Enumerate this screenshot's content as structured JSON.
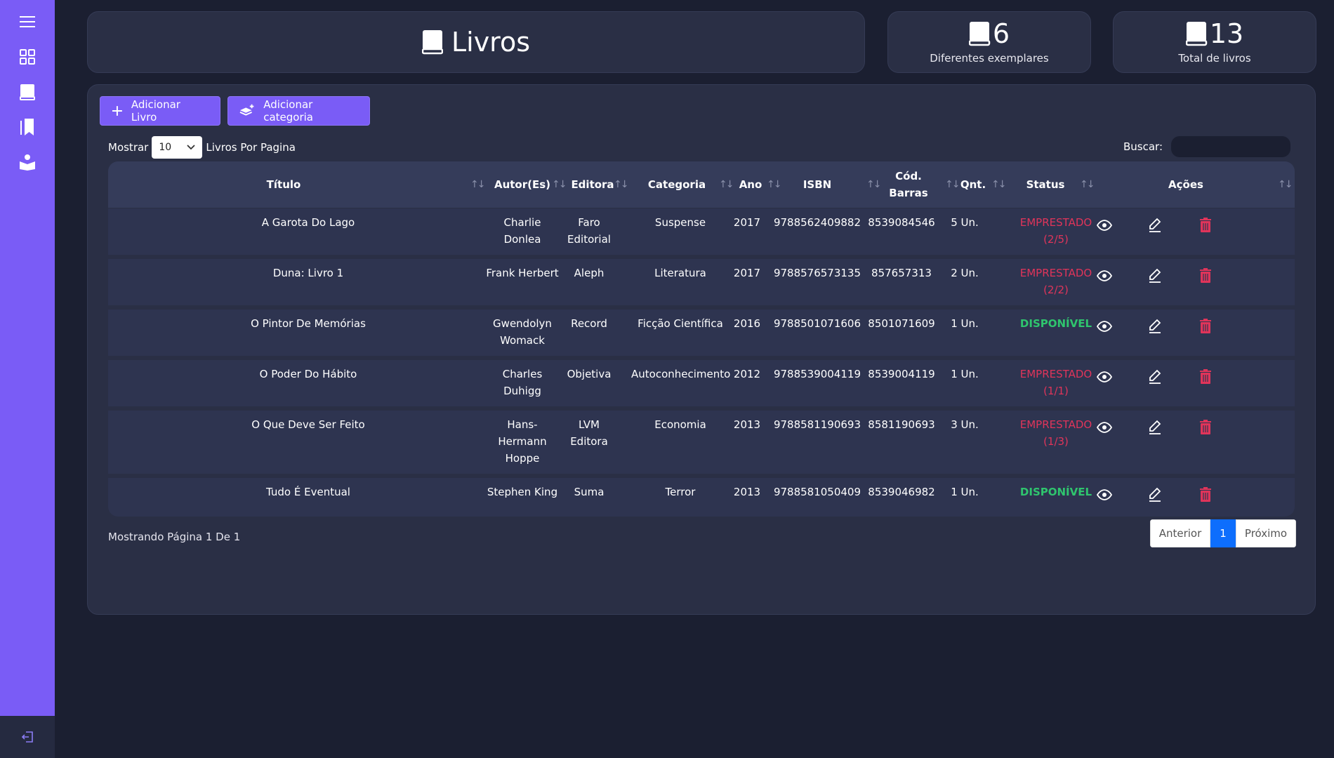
{
  "page": {
    "title": "Livros"
  },
  "stats": [
    {
      "value": "6",
      "label": "Diferentes exemplares"
    },
    {
      "value": "13",
      "label": "Total de livros"
    }
  ],
  "actions": {
    "add_book": "Adicionar Livro",
    "add_category": "Adicionar categoria"
  },
  "controls": {
    "show_label": "Mostrar",
    "page_size": "10",
    "per_page_label": "Livros Por Pagina",
    "search_label": "Buscar:",
    "search_value": ""
  },
  "table": {
    "headers": {
      "titulo": "Título",
      "autor": "Autor(Es)",
      "editora": "Editora",
      "categoria": "Categoria",
      "ano": "Ano",
      "isbn": "ISBN",
      "barras_1": "Cód.",
      "barras_2": "Barras",
      "qnt": "Qnt.",
      "status": "Status",
      "acoes": "Ações"
    },
    "rows": [
      {
        "titulo": "A Garota Do Lago",
        "autor": [
          "Charlie",
          "Donlea"
        ],
        "editora": [
          "Faro",
          "Editorial"
        ],
        "categoria": "Suspense",
        "ano": "2017",
        "isbn": "9788562409882",
        "barras": "8539084546",
        "qnt": "5 Un.",
        "status": [
          "EMPRESTADO",
          "(2/5)"
        ],
        "status_type": "emprestado"
      },
      {
        "titulo": "Duna: Livro 1",
        "autor": [
          "Frank Herbert"
        ],
        "editora": [
          "Aleph"
        ],
        "categoria": "Literatura",
        "ano": "2017",
        "isbn": "9788576573135",
        "barras": "857657313",
        "qnt": "2 Un.",
        "status": [
          "EMPRESTADO",
          "(2/2)"
        ],
        "status_type": "emprestado"
      },
      {
        "titulo": "O Pintor De Memórias",
        "autor": [
          "Gwendolyn",
          "Womack"
        ],
        "editora": [
          "Record"
        ],
        "categoria": "Ficção Científica",
        "ano": "2016",
        "isbn": "9788501071606",
        "barras": "8501071609",
        "qnt": "1 Un.",
        "status": [
          "DISPONÍVEL"
        ],
        "status_type": "disponivel"
      },
      {
        "titulo": "O Poder Do Hábito",
        "autor": [
          "Charles",
          "Duhigg"
        ],
        "editora": [
          "Objetiva"
        ],
        "categoria": "Autoconhecimento",
        "ano": "2012",
        "isbn": "9788539004119",
        "barras": "8539004119",
        "qnt": "1 Un.",
        "status": [
          "EMPRESTADO",
          "(1/1)"
        ],
        "status_type": "emprestado"
      },
      {
        "titulo": "O Que Deve Ser Feito",
        "autor": [
          "Hans-",
          "Hermann",
          "Hoppe"
        ],
        "editora": [
          "LVM",
          "Editora"
        ],
        "categoria": "Economia",
        "ano": "2013",
        "isbn": "9788581190693",
        "barras": "8581190693",
        "qnt": "3 Un.",
        "status": [
          "EMPRESTADO",
          "(1/3)"
        ],
        "status_type": "emprestado"
      },
      {
        "titulo": "Tudo É Eventual",
        "autor": [
          "Stephen King"
        ],
        "editora": [
          "Suma"
        ],
        "categoria": "Terror",
        "ano": "2013",
        "isbn": "9788581050409",
        "barras": "8539046982",
        "qnt": "1 Un.",
        "status": [
          "DISPONÍVEL"
        ],
        "status_type": "disponivel"
      }
    ]
  },
  "footer": {
    "info": "Mostrando Página 1 De 1"
  },
  "pagination": {
    "prev": "Anterior",
    "current": "1",
    "next": "Próximo"
  },
  "colors": {
    "accent": "#7a5cf6",
    "background": "#1b1f31",
    "card": "#2a2f45",
    "emprestado": "#e0345a",
    "disponivel": "#2fc56e",
    "delete": "#e0345a"
  },
  "icons": {
    "sidebar": [
      "menu-icon",
      "dashboard-icon",
      "book-icon",
      "books-icon",
      "reader-icon"
    ],
    "logout": "logout-icon"
  }
}
